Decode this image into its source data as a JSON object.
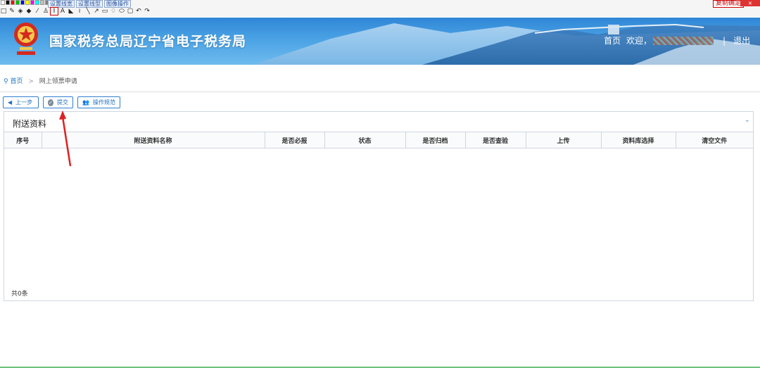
{
  "annotation_toolbar": {
    "palette_colors": [
      "#ffffff",
      "#000000",
      "#ff0000",
      "#00c000",
      "#0000ff",
      "#ffff00",
      "#ff00ff",
      "#00ffff",
      "#c0c0c0",
      "#808080"
    ],
    "menu": [
      "设置线宽",
      "设置线型",
      "图像操作"
    ],
    "tools": [
      "rectangle-icon",
      "pencil-icon",
      "eraser-icon",
      "fill-icon",
      "pen-icon",
      "brush-icon",
      "text-edit-icon",
      "text-icon",
      "bucket-icon",
      "curve-icon",
      "line-icon",
      "arrow-icon",
      "rect-outline-icon",
      "lasso-icon",
      "ellipse-icon",
      "rounded-rect-icon",
      "undo-icon",
      "redo-icon"
    ],
    "copy_label": "复制确定",
    "close_label": "×"
  },
  "header": {
    "title": "国家税务总局辽宁省电子税务局",
    "home_link": "首页",
    "welcome": "欢迎，",
    "separator": "|",
    "logout": "退出"
  },
  "breadcrumb": {
    "home": "首页",
    "separator": ">",
    "current": "网上领票申请"
  },
  "actions": {
    "prev": "上一步",
    "submit": "提交",
    "guide": "操作规范"
  },
  "panel": {
    "title": "附送资料",
    "columns": [
      "序号",
      "附送资料名称",
      "是否必报",
      "状态",
      "是否归档",
      "是否查验",
      "上传",
      "资料库选择",
      "清空文件"
    ],
    "total": "共0条"
  },
  "colors": {
    "banner_top": "#2f86d6",
    "accent": "#1f78c8",
    "arrow": "#e02020"
  }
}
